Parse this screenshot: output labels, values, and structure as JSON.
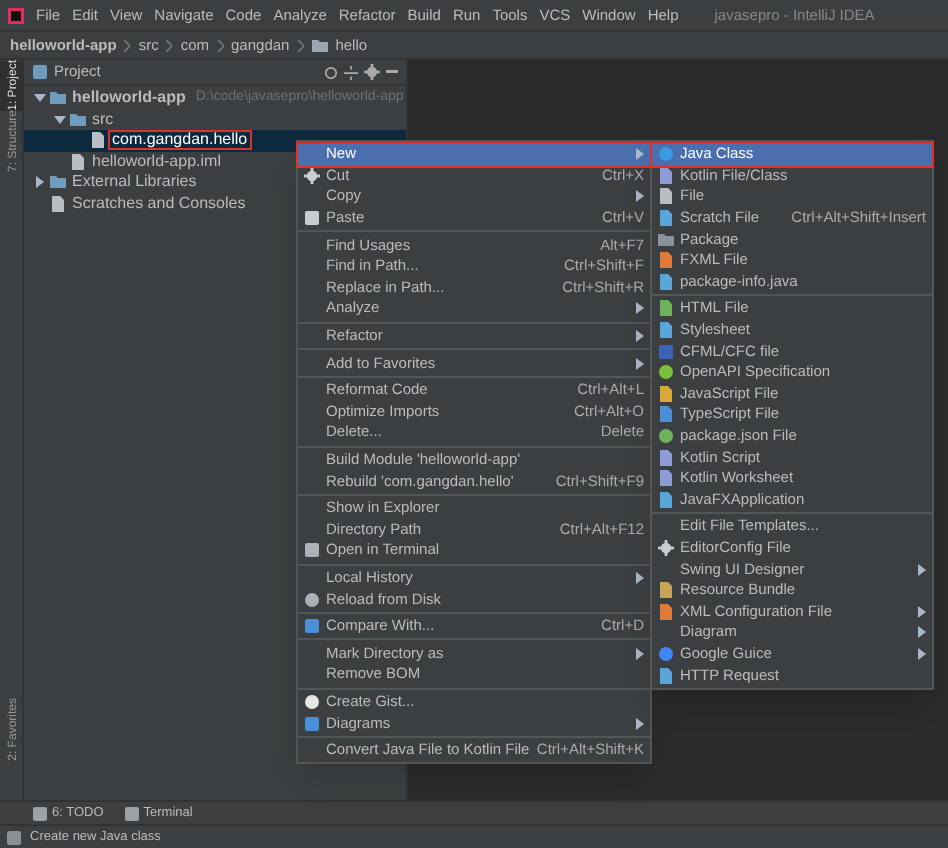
{
  "menu_bar": {
    "items": [
      "File",
      "Edit",
      "View",
      "Navigate",
      "Code",
      "Analyze",
      "Refactor",
      "Build",
      "Run",
      "Tools",
      "VCS",
      "Window",
      "Help"
    ],
    "title": "javasepro - IntelliJ IDEA"
  },
  "breadcrumb": [
    "helloworld-app",
    "src",
    "com",
    "gangdan",
    "hello"
  ],
  "side_tabs": [
    {
      "label": "1: Project",
      "selected": true
    },
    {
      "label": "7: Structure",
      "selected": false
    },
    {
      "label": "2: Favorites",
      "selected": false
    }
  ],
  "project_panel": {
    "title": "Project",
    "tree": [
      {
        "label": "helloworld-app",
        "path": "D:\\code\\javasepro\\helloworld-app",
        "expanded": true,
        "selected": false,
        "annotated": false,
        "children": [
          {
            "label": "src",
            "expanded": true,
            "selected": false,
            "annotated": false,
            "children": [
              {
                "label": "com.gangdan.hello",
                "selected": true,
                "annotated": true
              }
            ]
          },
          {
            "label": "helloworld-app.iml",
            "selected": false,
            "annotated": false
          }
        ]
      },
      {
        "label": "External Libraries",
        "expanded": false,
        "selected": false,
        "annotated": false
      },
      {
        "label": "Scratches and Consoles",
        "selected": false,
        "annotated": false
      }
    ]
  },
  "context_menu": {
    "items": [
      {
        "kind": "item",
        "label": "New",
        "has_submenu": true,
        "selected": true,
        "annotated": true
      },
      {
        "kind": "item",
        "label": "Cut",
        "shortcut": "Ctrl+X",
        "selected": false
      },
      {
        "kind": "item",
        "label": "Copy",
        "has_submenu": true,
        "selected": false
      },
      {
        "kind": "item",
        "label": "Paste",
        "shortcut": "Ctrl+V",
        "selected": false
      },
      {
        "kind": "separator"
      },
      {
        "kind": "item",
        "label": "Find Usages",
        "shortcut": "Alt+F7",
        "selected": false
      },
      {
        "kind": "item",
        "label": "Find in Path...",
        "shortcut": "Ctrl+Shift+F",
        "selected": false
      },
      {
        "kind": "item",
        "label": "Replace in Path...",
        "shortcut": "Ctrl+Shift+R",
        "selected": false
      },
      {
        "kind": "item",
        "label": "Analyze",
        "has_submenu": true,
        "selected": false
      },
      {
        "kind": "separator"
      },
      {
        "kind": "item",
        "label": "Refactor",
        "has_submenu": true,
        "selected": false
      },
      {
        "kind": "separator"
      },
      {
        "kind": "item",
        "label": "Add to Favorites",
        "has_submenu": true,
        "selected": false
      },
      {
        "kind": "separator"
      },
      {
        "kind": "item",
        "label": "Reformat Code",
        "shortcut": "Ctrl+Alt+L",
        "selected": false
      },
      {
        "kind": "item",
        "label": "Optimize Imports",
        "shortcut": "Ctrl+Alt+O",
        "selected": false
      },
      {
        "kind": "item",
        "label": "Delete...",
        "shortcut": "Delete",
        "selected": false
      },
      {
        "kind": "separator"
      },
      {
        "kind": "item",
        "label": "Build Module 'helloworld-app'",
        "selected": false
      },
      {
        "kind": "item",
        "label": "Rebuild 'com.gangdan.hello'",
        "shortcut": "Ctrl+Shift+F9",
        "selected": false
      },
      {
        "kind": "separator"
      },
      {
        "kind": "item",
        "label": "Show in Explorer",
        "selected": false
      },
      {
        "kind": "item",
        "label": "Directory Path",
        "shortcut": "Ctrl+Alt+F12",
        "selected": false
      },
      {
        "kind": "item",
        "label": "Open in Terminal",
        "selected": false
      },
      {
        "kind": "separator"
      },
      {
        "kind": "item",
        "label": "Local History",
        "has_submenu": true,
        "selected": false
      },
      {
        "kind": "item",
        "label": "Reload from Disk",
        "selected": false
      },
      {
        "kind": "separator"
      },
      {
        "kind": "item",
        "label": "Compare With...",
        "shortcut": "Ctrl+D",
        "selected": false
      },
      {
        "kind": "separator"
      },
      {
        "kind": "item",
        "label": "Mark Directory as",
        "has_submenu": true,
        "selected": false
      },
      {
        "kind": "item",
        "label": "Remove BOM",
        "selected": false
      },
      {
        "kind": "separator"
      },
      {
        "kind": "item",
        "label": "Create Gist...",
        "selected": false
      },
      {
        "kind": "item",
        "label": "Diagrams",
        "has_submenu": true,
        "selected": false
      },
      {
        "kind": "separator"
      },
      {
        "kind": "item",
        "label": "Convert Java File to Kotlin File",
        "shortcut": "Ctrl+Alt+Shift+K",
        "selected": false
      }
    ]
  },
  "new_submenu": {
    "items": [
      {
        "kind": "item",
        "label": "Java Class",
        "selected": true,
        "annotated": true
      },
      {
        "kind": "item",
        "label": "Kotlin File/Class",
        "selected": false
      },
      {
        "kind": "item",
        "label": "File",
        "selected": false
      },
      {
        "kind": "item",
        "label": "Scratch File",
        "shortcut": "Ctrl+Alt+Shift+Insert",
        "selected": false
      },
      {
        "kind": "item",
        "label": "Package",
        "selected": false
      },
      {
        "kind": "item",
        "label": "FXML File",
        "selected": false
      },
      {
        "kind": "item",
        "label": "package-info.java",
        "selected": false
      },
      {
        "kind": "separator"
      },
      {
        "kind": "item",
        "label": "HTML File",
        "selected": false
      },
      {
        "kind": "item",
        "label": "Stylesheet",
        "selected": false
      },
      {
        "kind": "item",
        "label": "CFML/CFC file",
        "selected": false
      },
      {
        "kind": "item",
        "label": "OpenAPI Specification",
        "selected": false
      },
      {
        "kind": "item",
        "label": "JavaScript File",
        "selected": false
      },
      {
        "kind": "item",
        "label": "TypeScript File",
        "selected": false
      },
      {
        "kind": "item",
        "label": "package.json File",
        "selected": false
      },
      {
        "kind": "item",
        "label": "Kotlin Script",
        "selected": false
      },
      {
        "kind": "item",
        "label": "Kotlin Worksheet",
        "selected": false
      },
      {
        "kind": "item",
        "label": "JavaFXApplication",
        "selected": false
      },
      {
        "kind": "separator"
      },
      {
        "kind": "item",
        "label": "Edit File Templates...",
        "selected": false
      },
      {
        "kind": "item",
        "label": "EditorConfig File",
        "selected": false
      },
      {
        "kind": "item",
        "label": "Swing UI Designer",
        "has_submenu": true,
        "selected": false
      },
      {
        "kind": "item",
        "label": "Resource Bundle",
        "selected": false
      },
      {
        "kind": "item",
        "label": "XML Configuration File",
        "has_submenu": true,
        "selected": false
      },
      {
        "kind": "item",
        "label": "Diagram",
        "has_submenu": true,
        "selected": false
      },
      {
        "kind": "item",
        "label": "Google Guice",
        "has_submenu": true,
        "selected": false
      },
      {
        "kind": "item",
        "label": "HTTP Request",
        "selected": false
      }
    ]
  },
  "tool_window_bar": [
    "6: TODO",
    "Terminal"
  ],
  "status_bar": "Create new Java class"
}
